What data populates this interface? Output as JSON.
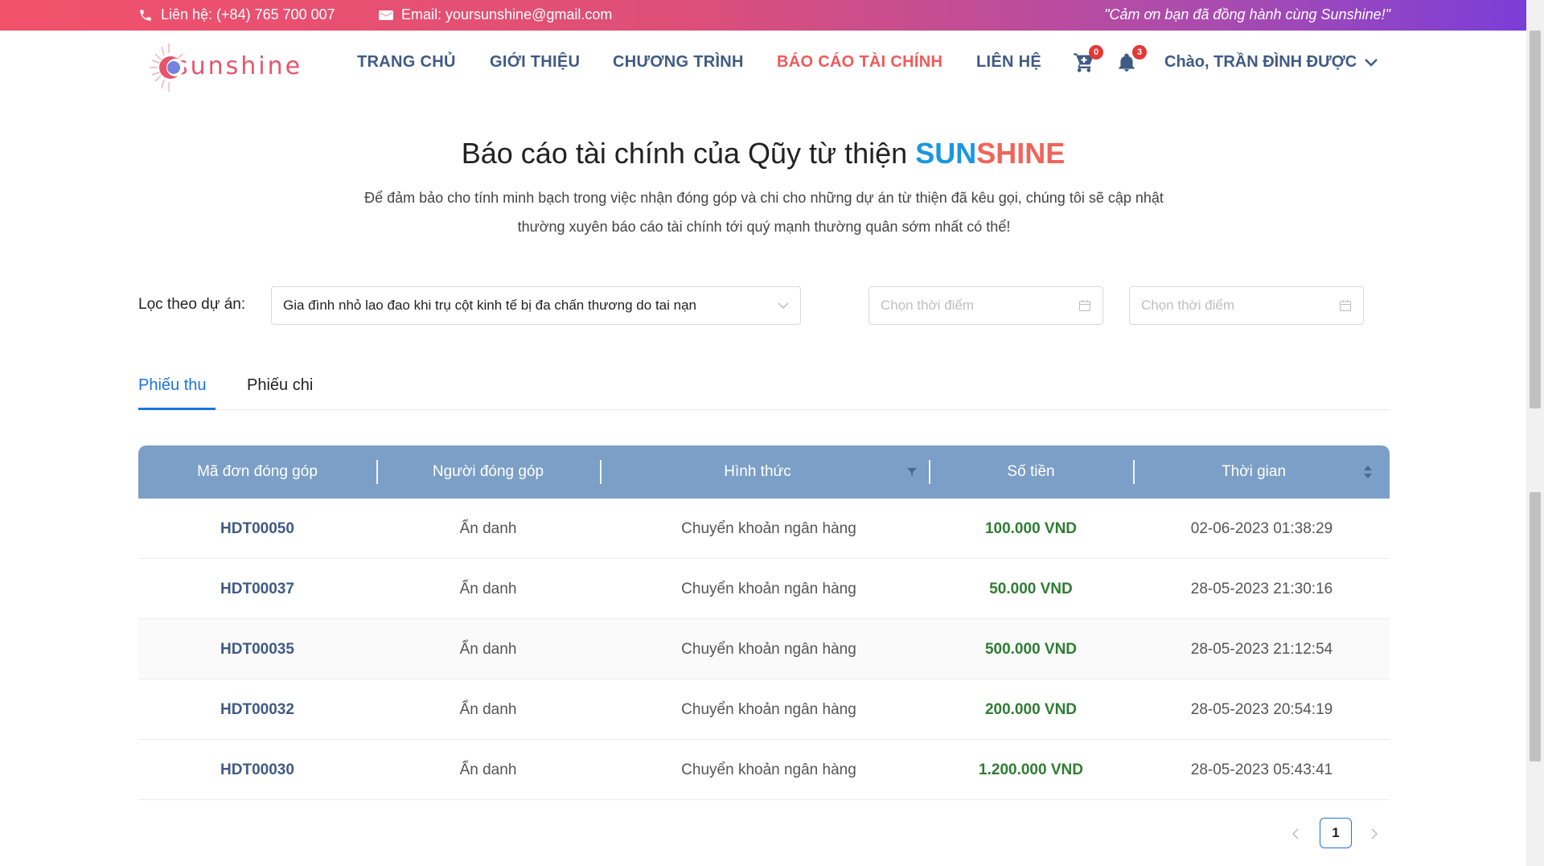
{
  "topbar": {
    "contact": "Liên hệ:  (+84) 765 700 007",
    "email": "Email:  yoursunshine@gmail.com",
    "slogan": "\"Cảm ơn bạn đã đồng hành cùng Sunshine!\""
  },
  "brand": {
    "logo_text": "sunshine",
    "accent": "#f05a5a",
    "primary": "#3f5a85"
  },
  "nav": {
    "items": [
      "TRANG CHỦ",
      "GIỚI THIỆU",
      "CHƯƠNG TRÌNH",
      "BÁO CÁO TÀI CHÍNH",
      "LIÊN HỆ"
    ],
    "active": "BÁO CÁO TÀI CHÍNH",
    "cart_count": "0",
    "notification_count": "3",
    "user_greeting": "Chào, TRẦN ĐÌNH ĐƯỢC"
  },
  "hero": {
    "title_prefix": "Báo cáo tài chính của Qũy từ thiện ",
    "title_sun": "SUN",
    "title_shine": "SHINE",
    "desc_line1": "Để đảm bảo cho tính minh bạch trong việc nhận đóng góp và chi cho những dự án từ thiện đã kêu gọi, chúng tôi sẽ cập nhật",
    "desc_line2": "thường xuyên báo cáo tài chính tới quý mạnh thường quân sớm nhất có thể!"
  },
  "filter": {
    "label": "Lọc theo dự án:",
    "selected_project": "Gia đình nhỏ lao đao khi trụ cột kinh tế bị đa chấn thương do tai nạn",
    "date_from_placeholder": "Chọn thời điểm",
    "date_to_placeholder": "Chọn thời điểm"
  },
  "tabs": {
    "receipts": "Phiếu thu",
    "expenses": "Phiếu chi",
    "active": "Phiếu thu"
  },
  "table": {
    "headers": [
      "Mã đơn đóng góp",
      "Người đóng góp",
      "Hình thức",
      "Số tiền",
      "Thời gian"
    ],
    "rows": [
      {
        "code": "HDT00050",
        "donor": "Ẩn danh",
        "method": "Chuyển khoản ngân hàng",
        "amount": "100.000 VND",
        "time": "02-06-2023 01:38:29"
      },
      {
        "code": "HDT00037",
        "donor": "Ẩn danh",
        "method": "Chuyển khoản ngân hàng",
        "amount": "50.000 VND",
        "time": "28-05-2023 21:30:16"
      },
      {
        "code": "HDT00035",
        "donor": "Ẩn danh",
        "method": "Chuyển khoản ngân hàng",
        "amount": "500.000 VND",
        "time": "28-05-2023 21:12:54"
      },
      {
        "code": "HDT00032",
        "donor": "Ẩn danh",
        "method": "Chuyển khoản ngân hàng",
        "amount": "200.000 VND",
        "time": "28-05-2023 20:54:19"
      },
      {
        "code": "HDT00030",
        "donor": "Ẩn danh",
        "method": "Chuyển khoản ngân hàng",
        "amount": "1.200.000 VND",
        "time": "28-05-2023 05:43:41"
      }
    ]
  },
  "pagination": {
    "current_page": "1"
  }
}
